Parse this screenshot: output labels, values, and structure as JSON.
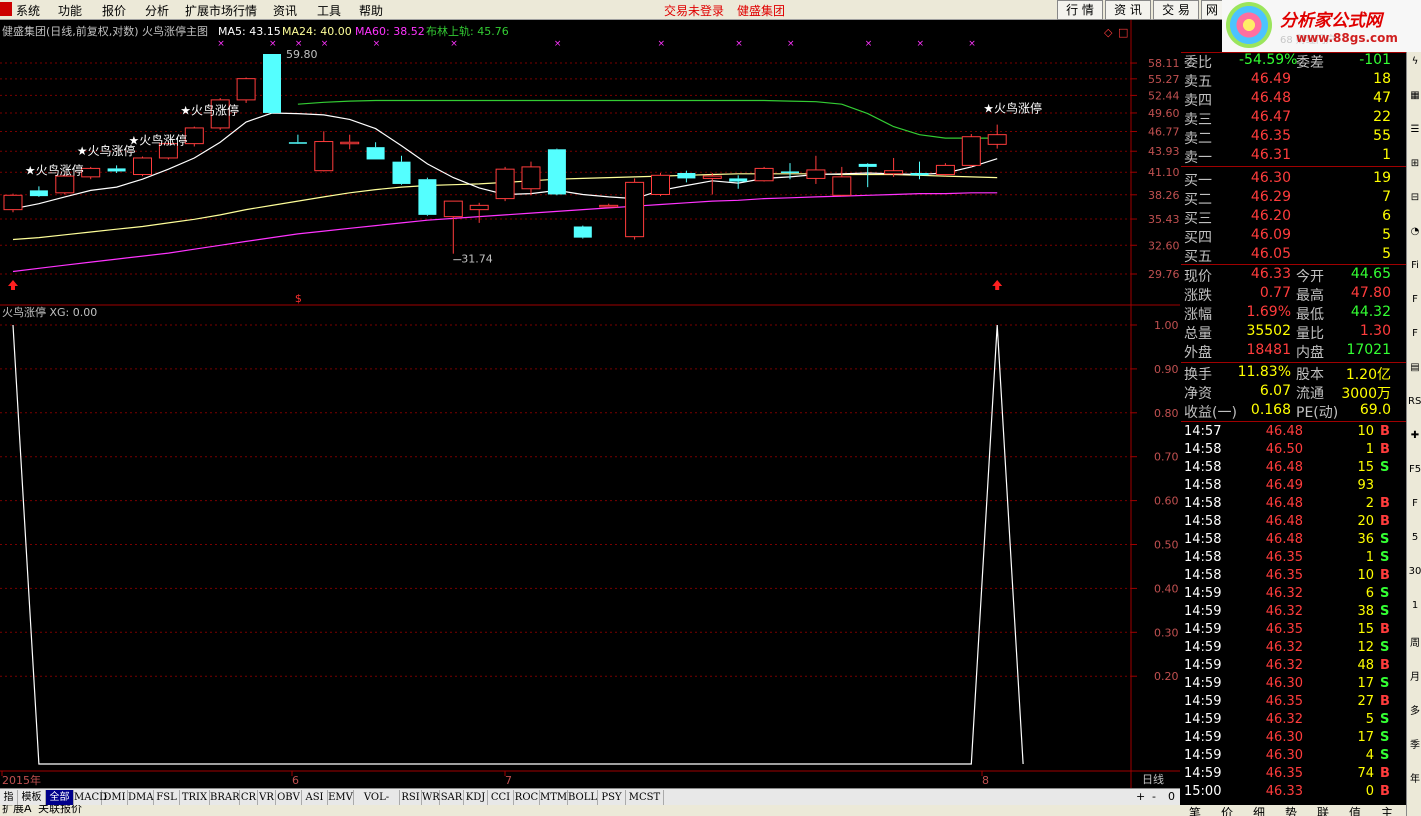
{
  "colors": {
    "up": "#ff3c3c",
    "down": "#54ffff",
    "ma5": "#ffffff",
    "ma24": "#ffff99",
    "ma60": "#ff33ff",
    "boll": "#33cc33",
    "grid": "#7a0000",
    "yellow": "#ffff00",
    "green": "#33ff33",
    "red_price": "#ff3c3c"
  },
  "menu": {
    "items": [
      "系统",
      "功能",
      "报价",
      "分析",
      "扩展市场行情",
      "资讯",
      "工具",
      "帮助"
    ],
    "status": [
      "交易未登录",
      "健盛集团"
    ],
    "buttons": [
      "行 情",
      "资 讯",
      "交 易",
      "网"
    ]
  },
  "logo": {
    "title": "分析家公式网",
    "url": "www.88gs.com",
    "faded": "68 财经门户"
  },
  "main_chart": {
    "header": {
      "stock": "健盛集团(日线,前复权,对数)",
      "indicator": "火鸟涨停主图",
      "ma5": "MA5: 43.15",
      "ma24": "MA24: 40.00",
      "ma60": "MA60: 38.52",
      "boll": "布林上轨: 45.76"
    },
    "y_ticks": [
      "58.11",
      "55.27",
      "52.44",
      "49.60",
      "46.77",
      "43.93",
      "41.10",
      "38.26",
      "35.43",
      "32.60",
      "29.76"
    ],
    "annotations": {
      "high": "59.80",
      "low": "31.74",
      "signal": "★火鸟涨停",
      "dollar": "$",
      "xmark": "×"
    }
  },
  "chart_data": {
    "type": "candlestick",
    "y_scale": "log",
    "ylim": [
      29.76,
      59.8
    ],
    "candles": [
      {
        "o": 36.5,
        "h": 38.4,
        "l": 36.2,
        "c": 38.2
      },
      {
        "o": 38.8,
        "h": 39.3,
        "l": 38.0,
        "c": 38.1
      },
      {
        "o": 38.5,
        "h": 40.8,
        "l": 38.3,
        "c": 40.6
      },
      {
        "o": 40.5,
        "h": 41.8,
        "l": 40.2,
        "c": 41.6
      },
      {
        "o": 41.6,
        "h": 42.0,
        "l": 41.0,
        "c": 41.2
      },
      {
        "o": 40.8,
        "h": 43.2,
        "l": 40.6,
        "c": 43.0
      },
      {
        "o": 43.0,
        "h": 45.2,
        "l": 42.8,
        "c": 45.0
      },
      {
        "o": 45.0,
        "h": 47.5,
        "l": 44.6,
        "c": 47.3
      },
      {
        "o": 47.3,
        "h": 52.0,
        "l": 47.0,
        "c": 51.7
      },
      {
        "o": 51.7,
        "h": 55.5,
        "l": 51.2,
        "c": 55.3
      },
      {
        "o": 59.8,
        "h": 59.8,
        "l": 49.5,
        "c": 49.6
      },
      {
        "o": 45.2,
        "h": 46.3,
        "l": 45.0,
        "c": 45.1
      },
      {
        "o": 41.3,
        "h": 46.8,
        "l": 41.2,
        "c": 45.3
      },
      {
        "o": 45.2,
        "h": 46.3,
        "l": 44.2,
        "c": 45.2
      },
      {
        "o": 44.5,
        "h": 45.2,
        "l": 42.8,
        "c": 42.8
      },
      {
        "o": 42.5,
        "h": 43.3,
        "l": 39.5,
        "c": 39.6
      },
      {
        "o": 40.2,
        "h": 40.4,
        "l": 35.8,
        "c": 35.9
      },
      {
        "o": 35.7,
        "h": 37.5,
        "l": 31.74,
        "c": 37.5
      },
      {
        "o": 36.5,
        "h": 37.3,
        "l": 35.0,
        "c": 37.0
      },
      {
        "o": 37.8,
        "h": 41.8,
        "l": 37.5,
        "c": 41.5
      },
      {
        "o": 39.0,
        "h": 42.5,
        "l": 38.2,
        "c": 41.8
      },
      {
        "o": 44.2,
        "h": 44.3,
        "l": 38.2,
        "c": 38.3
      },
      {
        "o": 34.6,
        "h": 34.7,
        "l": 33.3,
        "c": 33.4
      },
      {
        "o": 37.0,
        "h": 37.2,
        "l": 36.9,
        "c": 37.0
      },
      {
        "o": 33.5,
        "h": 40.3,
        "l": 33.2,
        "c": 39.8
      },
      {
        "o": 38.3,
        "h": 41.0,
        "l": 38.1,
        "c": 40.7
      },
      {
        "o": 41.0,
        "h": 41.3,
        "l": 39.8,
        "c": 40.3
      },
      {
        "o": 40.3,
        "h": 41.0,
        "l": 38.3,
        "c": 40.6
      },
      {
        "o": 40.3,
        "h": 40.7,
        "l": 39.0,
        "c": 39.9
      },
      {
        "o": 40.0,
        "h": 41.8,
        "l": 39.9,
        "c": 41.6
      },
      {
        "o": 41.2,
        "h": 42.3,
        "l": 40.2,
        "c": 41.1
      },
      {
        "o": 40.3,
        "h": 43.3,
        "l": 39.6,
        "c": 41.4
      },
      {
        "o": 38.2,
        "h": 41.8,
        "l": 38.1,
        "c": 40.5
      },
      {
        "o": 42.2,
        "h": 42.3,
        "l": 39.2,
        "c": 41.8
      },
      {
        "o": 40.9,
        "h": 43.0,
        "l": 40.5,
        "c": 41.3
      },
      {
        "o": 41.0,
        "h": 42.5,
        "l": 40.2,
        "c": 40.7
      },
      {
        "o": 40.8,
        "h": 42.3,
        "l": 40.6,
        "c": 42.0
      },
      {
        "o": 42.0,
        "h": 46.4,
        "l": 41.8,
        "c": 46.0
      },
      {
        "o": 44.9,
        "h": 47.8,
        "l": 44.3,
        "c": 46.3
      }
    ],
    "ma5": [
      36.6,
      37.2,
      38.0,
      38.8,
      39.2,
      40.2,
      41.5,
      43.0,
      45.2,
      48.2,
      49.6,
      49.5,
      49.3,
      48.6,
      47.2,
      44.7,
      42.2,
      40.4,
      39.1,
      38.3,
      38.4,
      38.8,
      38.3,
      38.0,
      37.8,
      38.8,
      39.4,
      40.0,
      39.7,
      40.3,
      40.5,
      40.8,
      40.9,
      41.0,
      40.9,
      40.8,
      41.0,
      41.8,
      42.9
    ],
    "ma24": [
      33.2,
      33.4,
      33.7,
      34.0,
      34.3,
      34.6,
      35.0,
      35.4,
      35.9,
      36.5,
      37.0,
      37.5,
      38.0,
      38.5,
      38.9,
      39.2,
      39.4,
      39.5,
      39.6,
      39.8,
      40.0,
      40.2,
      40.3,
      40.4,
      40.5,
      40.6,
      40.7,
      40.8,
      40.9,
      40.9,
      40.9,
      40.9,
      40.8,
      40.8,
      40.8,
      40.7,
      40.6,
      40.5,
      40.4
    ],
    "ma60": [
      30.0,
      30.3,
      30.6,
      30.9,
      31.2,
      31.5,
      31.8,
      32.2,
      32.6,
      33.0,
      33.4,
      33.8,
      34.1,
      34.4,
      34.7,
      35.0,
      35.3,
      35.5,
      35.7,
      35.9,
      36.1,
      36.3,
      36.5,
      36.7,
      36.9,
      37.1,
      37.3,
      37.5,
      37.6,
      37.8,
      37.9,
      38.0,
      38.1,
      38.2,
      38.3,
      38.4,
      38.4,
      38.5,
      38.5
    ],
    "boll_upper": [
      null,
      null,
      null,
      null,
      null,
      null,
      null,
      null,
      null,
      null,
      null,
      51.0,
      51.3,
      51.5,
      51.6,
      51.6,
      51.6,
      51.6,
      51.6,
      51.6,
      51.6,
      51.6,
      51.6,
      51.6,
      51.6,
      51.6,
      51.6,
      51.6,
      51.6,
      51.6,
      51.5,
      51.4,
      51.0,
      49.5,
      47.5,
      46.3,
      45.8,
      45.8,
      45.8
    ],
    "signal_days": [
      1,
      3,
      5,
      7,
      38
    ],
    "sub_chart": {
      "title": "火鸟涨停 XG: 0.00",
      "y_ticks": [
        "1.00",
        "0.90",
        "0.80",
        "0.70",
        "0.60",
        "0.50",
        "0.40",
        "0.30",
        "0.20"
      ],
      "values": [
        1,
        0,
        0,
        0,
        0,
        0,
        0,
        0,
        0,
        0,
        0,
        0,
        0,
        0,
        0,
        0,
        0,
        0,
        0,
        0,
        0,
        0,
        0,
        0,
        0,
        0,
        0,
        0,
        0,
        0,
        0,
        0,
        0,
        0,
        0,
        0,
        0,
        0,
        1,
        0
      ]
    },
    "x_labels": [
      "2015年",
      "6",
      "7",
      "8"
    ],
    "period": "日线"
  },
  "quote": {
    "weibi": {
      "label": "委比",
      "value": "-54.59%",
      "label2": "委差",
      "value2": "-101"
    },
    "asks": [
      {
        "label": "卖五",
        "price": "46.49",
        "vol": "18"
      },
      {
        "label": "卖四",
        "price": "46.48",
        "vol": "47"
      },
      {
        "label": "卖三",
        "price": "46.47",
        "vol": "22"
      },
      {
        "label": "卖二",
        "price": "46.35",
        "vol": "55"
      },
      {
        "label": "卖一",
        "price": "46.31",
        "vol": "1"
      }
    ],
    "bids": [
      {
        "label": "买一",
        "price": "46.30",
        "vol": "19"
      },
      {
        "label": "买二",
        "price": "46.29",
        "vol": "7"
      },
      {
        "label": "买三",
        "price": "46.20",
        "vol": "6"
      },
      {
        "label": "买四",
        "price": "46.09",
        "vol": "5"
      },
      {
        "label": "买五",
        "price": "46.05",
        "vol": "5"
      }
    ],
    "stats1": [
      {
        "l1": "现价",
        "v1": "46.33",
        "l2": "今开",
        "v2": "44.65"
      },
      {
        "l1": "涨跌",
        "v1": "0.77",
        "l2": "最高",
        "v2": "47.80"
      },
      {
        "l1": "涨幅",
        "v1": "1.69%",
        "l2": "最低",
        "v2": "44.32"
      },
      {
        "l1": "总量",
        "v1": "35502",
        "l2": "量比",
        "v2": "1.30"
      },
      {
        "l1": "外盘",
        "v1": "18481",
        "l2": "内盘",
        "v2": "17021"
      }
    ],
    "stats2": [
      {
        "l1": "换手",
        "v1": "11.83%",
        "l2": "股本",
        "v2": "1.20亿"
      },
      {
        "l1": "净资",
        "v1": "6.07",
        "l2": "流通",
        "v2": "3000万"
      },
      {
        "l1": "收益(一)",
        "v1": "0.168",
        "l2": "PE(动)",
        "v2": "69.0"
      }
    ]
  },
  "ticks": [
    {
      "t": "14:57",
      "p": "46.48",
      "v": "10",
      "f": "B"
    },
    {
      "t": "14:58",
      "p": "46.50",
      "v": "1",
      "f": "B"
    },
    {
      "t": "14:58",
      "p": "46.48",
      "v": "15",
      "f": "S"
    },
    {
      "t": "14:58",
      "p": "46.49",
      "v": "93",
      "f": ""
    },
    {
      "t": "14:58",
      "p": "46.48",
      "v": "2",
      "f": "B"
    },
    {
      "t": "14:58",
      "p": "46.48",
      "v": "20",
      "f": "B"
    },
    {
      "t": "14:58",
      "p": "46.48",
      "v": "36",
      "f": "S"
    },
    {
      "t": "14:58",
      "p": "46.35",
      "v": "1",
      "f": "S"
    },
    {
      "t": "14:58",
      "p": "46.35",
      "v": "10",
      "f": "B"
    },
    {
      "t": "14:59",
      "p": "46.32",
      "v": "6",
      "f": "S"
    },
    {
      "t": "14:59",
      "p": "46.32",
      "v": "38",
      "f": "S"
    },
    {
      "t": "14:59",
      "p": "46.35",
      "v": "15",
      "f": "B"
    },
    {
      "t": "14:59",
      "p": "46.32",
      "v": "12",
      "f": "S"
    },
    {
      "t": "14:59",
      "p": "46.32",
      "v": "48",
      "f": "B"
    },
    {
      "t": "14:59",
      "p": "46.30",
      "v": "17",
      "f": "S"
    },
    {
      "t": "14:59",
      "p": "46.35",
      "v": "27",
      "f": "B"
    },
    {
      "t": "14:59",
      "p": "46.32",
      "v": "5",
      "f": "S"
    },
    {
      "t": "14:59",
      "p": "46.30",
      "v": "17",
      "f": "S"
    },
    {
      "t": "14:59",
      "p": "46.30",
      "v": "4",
      "f": "S"
    },
    {
      "t": "14:59",
      "p": "46.35",
      "v": "74",
      "f": "B"
    },
    {
      "t": "15:00",
      "p": "46.33",
      "v": "0",
      "f": "B"
    }
  ],
  "tabs": [
    "指标",
    "模板",
    "全部",
    "MACD",
    "DMI",
    "DMA",
    "FSL",
    "TRIX",
    "BRAR",
    "CR",
    "VR",
    "OBV",
    "ASI",
    "EMV",
    "VOL-TDX",
    "RSI",
    "WR",
    "SAR",
    "KDJ",
    "CCI",
    "ROC",
    "MTM",
    "BOLL",
    "PSY",
    "MCST"
  ],
  "zoom": {
    "plus": "+",
    "minus": "-",
    "zero": "0"
  },
  "status": {
    "left": "扩展A",
    "right": "关联报价"
  },
  "bottom_tabs": [
    "笔",
    "价",
    "细",
    "势",
    "联",
    "值",
    "主"
  ],
  "right_strip": [
    "ϟ",
    "▦",
    "☰",
    "⊞",
    "⊟",
    "◔",
    "Fi",
    "F",
    "F",
    "▤",
    "RSI",
    "✚",
    "F5",
    "F",
    "5",
    "30",
    "1",
    "周",
    "月",
    "多",
    "季",
    "年"
  ]
}
